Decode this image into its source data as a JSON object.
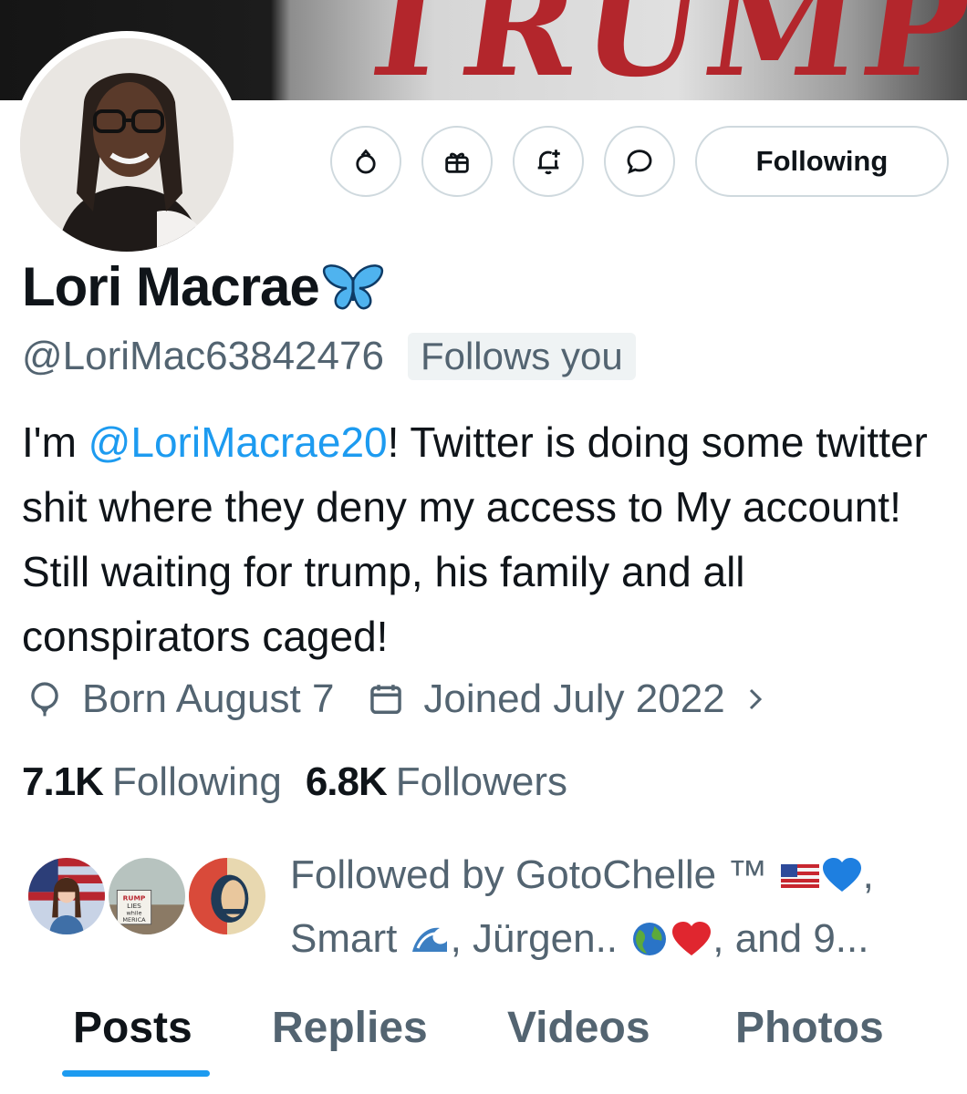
{
  "banner": {
    "text": "TRUMP"
  },
  "actions": {
    "following_label": "Following"
  },
  "profile": {
    "display_name": "Lori Macrae",
    "handle": "@LoriMac63842476",
    "follows_you": "Follows you"
  },
  "bio": {
    "prefix": "I'm ",
    "mention": "@LoriMacrae20",
    "text": "! Twitter is doing some twitter shit where they deny my access to My account! Still waiting for trump, his family and all conspirators caged!"
  },
  "meta": {
    "born": "Born August 7",
    "joined": "Joined July 2022"
  },
  "stats": {
    "following_count": "7.1K",
    "following_label": "Following",
    "followers_count": "6.8K",
    "followers_label": "Followers"
  },
  "followed_by": {
    "part1": "Followed by GotoChelle ™ ",
    "part2": ",",
    "part3": "Smart ",
    "part4": ", Jürgen.. ",
    "part5": ", and 9..."
  },
  "tabs": [
    {
      "label": "Posts",
      "active": true
    },
    {
      "label": "Replies",
      "active": false
    },
    {
      "label": "Videos",
      "active": false
    },
    {
      "label": "Photos",
      "active": false
    }
  ],
  "colors": {
    "accent": "#1d9bf0",
    "secondary_text": "#536471",
    "border": "#cfd9de"
  }
}
